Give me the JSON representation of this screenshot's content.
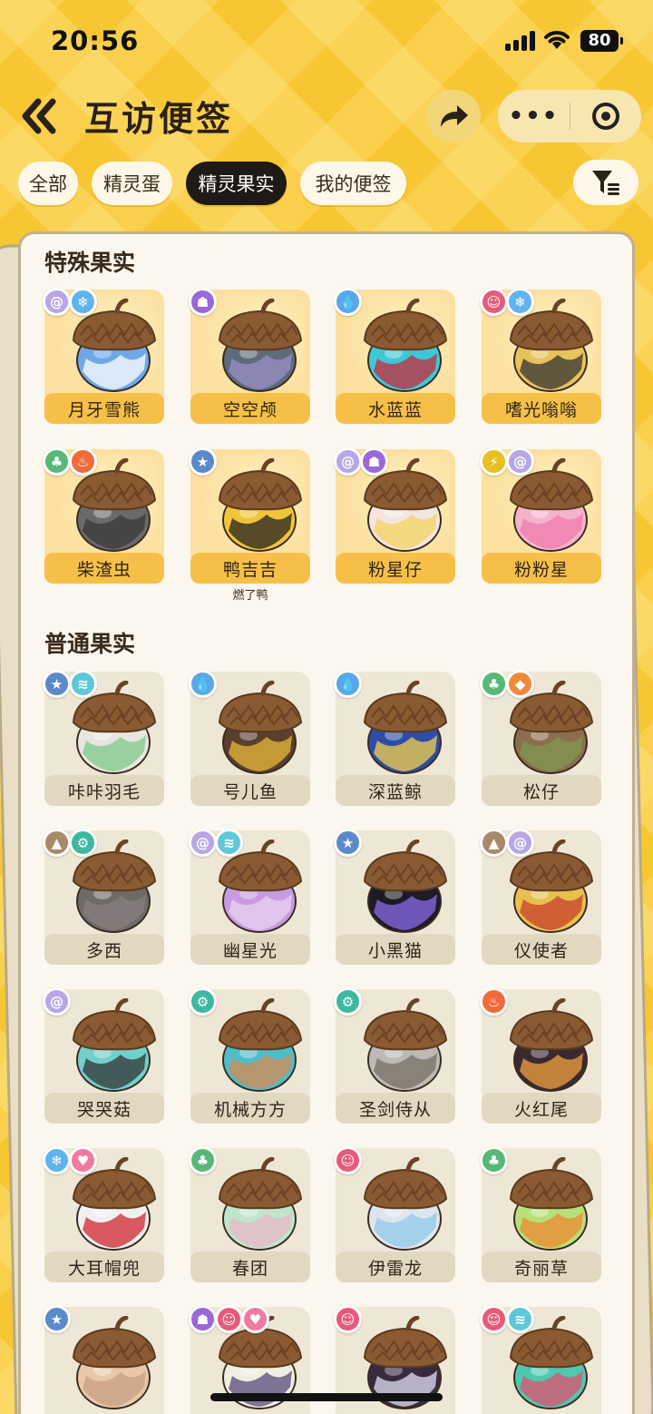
{
  "status_bar": {
    "time": "20:56",
    "battery": "80"
  },
  "header": {
    "title": "互访便签",
    "more_label": "•••"
  },
  "tabs": [
    {
      "label": "全部",
      "active": false
    },
    {
      "label": "精灵蛋",
      "active": false
    },
    {
      "label": "精灵果实",
      "active": true
    },
    {
      "label": "我的便签",
      "active": false
    }
  ],
  "sections": {
    "special": "特殊果实",
    "normal": "普通果实"
  },
  "special_fruits": [
    {
      "name": "月牙雪熊",
      "sub": "",
      "badges": [
        "psychic",
        "ice"
      ],
      "color": "#6FA8E8",
      "accent": "#ffffff"
    },
    {
      "name": "空空颅",
      "sub": "",
      "badges": [
        "ghost"
      ],
      "color": "#5E6B78",
      "accent": "#9B8FC8"
    },
    {
      "name": "水蓝蓝",
      "sub": "",
      "badges": [
        "water"
      ],
      "color": "#3FC7D6",
      "accent": "#C82A3A"
    },
    {
      "name": "嗜光嗡嗡",
      "sub": "",
      "badges": [
        "demon",
        "ice"
      ],
      "color": "#E8C25A",
      "accent": "#333333"
    },
    {
      "name": "柴渣虫",
      "sub": "",
      "badges": [
        "grass",
        "fire"
      ],
      "color": "#6A6A6A",
      "accent": "#3a3a3a"
    },
    {
      "name": "鸭吉吉",
      "sub": "燃了鸭",
      "badges": [
        "normal"
      ],
      "color": "#F2C43A",
      "accent": "#222222"
    },
    {
      "name": "粉星仔",
      "sub": "",
      "badges": [
        "psychic",
        "ghost"
      ],
      "color": "#F3E6E2",
      "accent": "#F5D060"
    },
    {
      "name": "粉粉星",
      "sub": "",
      "badges": [
        "electric",
        "psychic"
      ],
      "color": "#F6B3CC",
      "accent": "#F07AAE"
    }
  ],
  "normal_fruits": [
    {
      "name": "咔咔羽毛",
      "badges": [
        "normal",
        "wing"
      ],
      "color": "#E9E6E0",
      "accent": "#7CC98A"
    },
    {
      "name": "号儿鱼",
      "badges": [
        "water"
      ],
      "color": "#5A3E2E",
      "accent": "#E8B83A"
    },
    {
      "name": "深蓝鲸",
      "badges": [
        "water"
      ],
      "color": "#2E4DA8",
      "accent": "#F4D048"
    },
    {
      "name": "松仔",
      "badges": [
        "grass",
        "rock"
      ],
      "color": "#8B6E4E",
      "accent": "#7E9A52"
    },
    {
      "name": "多西",
      "badges": [
        "earth",
        "machine"
      ],
      "color": "#6E6A68",
      "accent": "#8A8080"
    },
    {
      "name": "幽星光",
      "badges": [
        "psychic",
        "wing"
      ],
      "color": "#C79BE0",
      "accent": "#E8D4F2"
    },
    {
      "name": "小黑猫",
      "badges": [
        "normal"
      ],
      "color": "#1E1B26",
      "accent": "#8A6BE8"
    },
    {
      "name": "仪使者",
      "badges": [
        "earth",
        "psychic"
      ],
      "color": "#E8C050",
      "accent": "#C8402A"
    },
    {
      "name": "哭哭菇",
      "badges": [
        "psychic"
      ],
      "color": "#6FD0CC",
      "accent": "#333333"
    },
    {
      "name": "机械方方",
      "badges": [
        "machine"
      ],
      "color": "#4FBDC8",
      "accent": "#D88A50"
    },
    {
      "name": "圣剑侍从",
      "badges": [
        "machine"
      ],
      "color": "#BDB9B4",
      "accent": "#7A6F65"
    },
    {
      "name": "火红尾",
      "badges": [
        "fire"
      ],
      "color": "#3A2A30",
      "accent": "#F2A040"
    },
    {
      "name": "大耳帽兜",
      "badges": [
        "ice",
        "heart"
      ],
      "color": "#F0F0F0",
      "accent": "#D02830"
    },
    {
      "name": "春团",
      "badges": [
        "grass"
      ],
      "color": "#BFE6CC",
      "accent": "#E8B8C8"
    },
    {
      "name": "伊雷龙",
      "badges": [
        "demon"
      ],
      "color": "#DDE6EE",
      "accent": "#8FC8E8"
    },
    {
      "name": "奇丽草",
      "badges": [
        "grass"
      ],
      "color": "#B8E07A",
      "accent": "#F08A30"
    },
    {
      "name": "",
      "badges": [
        "normal"
      ],
      "color": "#E8C8A8",
      "accent": "#C8A080"
    },
    {
      "name": "",
      "badges": [
        "ghost",
        "demon",
        "heart"
      ],
      "color": "#F0EEE0",
      "accent": "#5A4A7A"
    },
    {
      "name": "",
      "badges": [
        "demon"
      ],
      "color": "#3A2A40",
      "accent": "#E0E0F0"
    },
    {
      "name": "",
      "badges": [
        "demon",
        "wing"
      ],
      "color": "#4FC8B0",
      "accent": "#E05070"
    }
  ],
  "badge_types": {
    "psychic": {
      "bg": "#B9A6E6",
      "glyph": "@"
    },
    "ice": {
      "bg": "#5EB4EC",
      "glyph": "❄"
    },
    "ghost": {
      "bg": "#9A68D8",
      "glyph": "☗"
    },
    "water": {
      "bg": "#58A8E8",
      "glyph": "💧"
    },
    "demon": {
      "bg": "#E85A7A",
      "glyph": "☺"
    },
    "grass": {
      "bg": "#58B878",
      "glyph": "♣"
    },
    "fire": {
      "bg": "#F06A3A",
      "glyph": "♨"
    },
    "normal": {
      "bg": "#5A8ACB",
      "glyph": "★"
    },
    "electric": {
      "bg": "#E8C020",
      "glyph": "⚡"
    },
    "wing": {
      "bg": "#5EC8D8",
      "glyph": "≋"
    },
    "rock": {
      "bg": "#F08A3A",
      "glyph": "◆"
    },
    "earth": {
      "bg": "#A88A6A",
      "glyph": "▲"
    },
    "machine": {
      "bg": "#3FB8A0",
      "glyph": "⚙"
    },
    "heart": {
      "bg": "#F07AA0",
      "glyph": "♥"
    }
  }
}
